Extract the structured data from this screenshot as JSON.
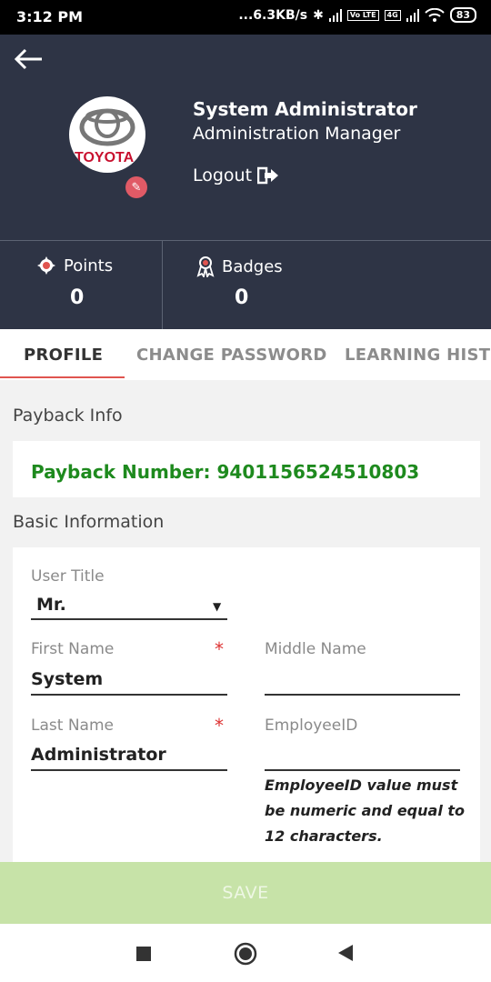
{
  "status_bar": {
    "time": "3:12 PM",
    "net_speed": "...6.3KB/s",
    "volte": "Vo LTE",
    "net_type": "4G",
    "battery": "83"
  },
  "header": {
    "user_name": "System Administrator",
    "user_role": "Administration Manager",
    "logout_label": "Logout",
    "avatar_text": "TOYOTA"
  },
  "stats": {
    "points_label": "Points",
    "points_value": "0",
    "badges_label": "Badges",
    "badges_value": "0"
  },
  "tabs": [
    {
      "label": "PROFILE",
      "active": true
    },
    {
      "label": "CHANGE PASSWORD",
      "active": false
    },
    {
      "label": "LEARNING HISTO",
      "active": false
    }
  ],
  "payback": {
    "section_title": "Payback Info",
    "number_text": "Payback Number: 9401156524510803"
  },
  "basic_info": {
    "section_title": "Basic Information",
    "user_title_label": "User Title",
    "user_title_value": "Mr.",
    "first_name_label": "First Name",
    "first_name_value": "System",
    "middle_name_label": "Middle Name",
    "middle_name_value": "",
    "last_name_label": "Last Name",
    "last_name_value": "Administrator",
    "employee_id_label": "EmployeeID",
    "employee_id_value": "",
    "required_mark": "*",
    "employee_id_hint": "EmployeeID value must be numeric and equal to 12 characters."
  },
  "save_label": "SAVE",
  "colors": {
    "header_bg": "#2e3445",
    "accent_red": "#e0544f",
    "payback_green": "#1e8a1e",
    "save_bg": "#c7e3a8"
  }
}
